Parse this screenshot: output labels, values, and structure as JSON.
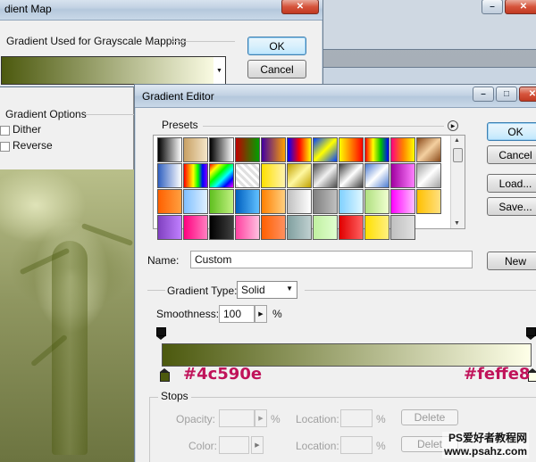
{
  "gradient_map": {
    "title": "dient Map",
    "section_label": "Gradient Used for Grayscale Mapping",
    "options_label": "Gradient Options",
    "dither_label": "Dither",
    "reverse_label": "Reverse",
    "ok_label": "OK",
    "cancel_label": "Cancel",
    "gradient_start": "#4c590e",
    "gradient_end": "#feffe8"
  },
  "gradient_editor": {
    "title": "Gradient Editor",
    "presets_label": "Presets",
    "ok_label": "OK",
    "cancel_label": "Cancel",
    "load_label": "Load...",
    "save_label": "Save...",
    "name_label": "Name:",
    "name_value": "Custom",
    "new_label": "New",
    "gradient_type_label": "Gradient Type:",
    "gradient_type_value": "Solid",
    "smoothness_label": "Smoothness:",
    "smoothness_value": "100",
    "smoothness_unit": "%",
    "start_color_label": "#4c590e",
    "end_color_label": "#feffe8",
    "stops": {
      "label": "Stops",
      "opacity_label": "Opacity:",
      "opacity_unit": "%",
      "location_label": "Location:",
      "location_unit": "%",
      "delete_label": "Delete",
      "color_label": "Color:",
      "location2_label": "Location:",
      "location2_unit": "%",
      "delete2_label": "Delet"
    }
  },
  "watermark": {
    "line1": "PS爱好者教程网",
    "line2": "www.psahz.com"
  },
  "presets": [
    "linear-gradient(90deg,#000,#fff)",
    "linear-gradient(90deg,#c8a064,#f4e6c8)",
    "linear-gradient(90deg,#000,#fff)",
    "linear-gradient(90deg,#c00000,#00a000)",
    "linear-gradient(90deg,#4000a0,#ffa000)",
    "linear-gradient(90deg,#0000ff,#ff0000,#ffff00)",
    "linear-gradient(135deg,#0040ff,#ffff00 50%,#0040ff)",
    "linear-gradient(90deg,#ffff00,#ff8000,#ff0000)",
    "linear-gradient(90deg,#ff0000,#ffff00,#00c000,#0000ff)",
    "linear-gradient(90deg,#ff0080,#ff8000,#ffff00)",
    "linear-gradient(135deg,#8a4a1a,#f4d0a0 50%,#8a4a1a)",
    "linear-gradient(90deg,#3060c0,#fff)",
    "linear-gradient(90deg,#ff0000,#ff8000,#ffff00,#00ff00,#0000ff,#8000ff)",
    "linear-gradient(135deg,#ff0000,#ffff00,#00ff00,#00ffff,#0000ff,#ff00ff)",
    "repeating-linear-gradient(45deg,#e0e0e0 0 3px,#fff 3px 6px)",
    "linear-gradient(90deg,#ffe000,#fff4b0)",
    "linear-gradient(135deg,#c0a000,#fff8a0 50%,#c0a000)",
    "linear-gradient(135deg,#505050,#f0f0f0 50%,#505050)",
    "linear-gradient(135deg,#404040,#ffffff 50%,#404040)",
    "linear-gradient(135deg,#4a7ad0,#fff 50%,#4a7ad0)",
    "linear-gradient(90deg,#a000a0,#ff80ff)",
    "linear-gradient(135deg,#a0a0a0,#fff 50%,#a0a0a0)",
    "linear-gradient(90deg,#ff6000,#ffa040)",
    "linear-gradient(90deg,#80c0ff,#e0f0ff)",
    "linear-gradient(90deg,#60c020,#c0f080)",
    "linear-gradient(90deg,#0060c0,#60c0ff)",
    "linear-gradient(90deg,#ff8000,#ffd080)",
    "linear-gradient(90deg,#c0c0c0,#fff)",
    "linear-gradient(90deg,#808080,#c0c0c0)",
    "linear-gradient(90deg,#80d0ff,#e0f8ff)",
    "linear-gradient(90deg,#b0e080,#f0ffd0)",
    "linear-gradient(90deg,#ff00ff,#ffc0ff)",
    "linear-gradient(90deg,#ffc000,#ffe080)",
    "linear-gradient(90deg,#8040c0,#c080ff)",
    "linear-gradient(90deg,#ff0080,#ff80c0)",
    "linear-gradient(90deg,#000,#404040)",
    "linear-gradient(90deg,#ff40a0,#ffc0e0)",
    "linear-gradient(90deg,#ff6000,#ff9060)",
    "linear-gradient(90deg,#80a0a0,#c0d0d0)",
    "linear-gradient(90deg,#c0f0a0,#e0ffd0)",
    "linear-gradient(90deg,#e00000,#ff6060)",
    "linear-gradient(90deg,#ffe000,#fff080)",
    "linear-gradient(90deg,#c0c0c0,#e0e0e0)"
  ]
}
